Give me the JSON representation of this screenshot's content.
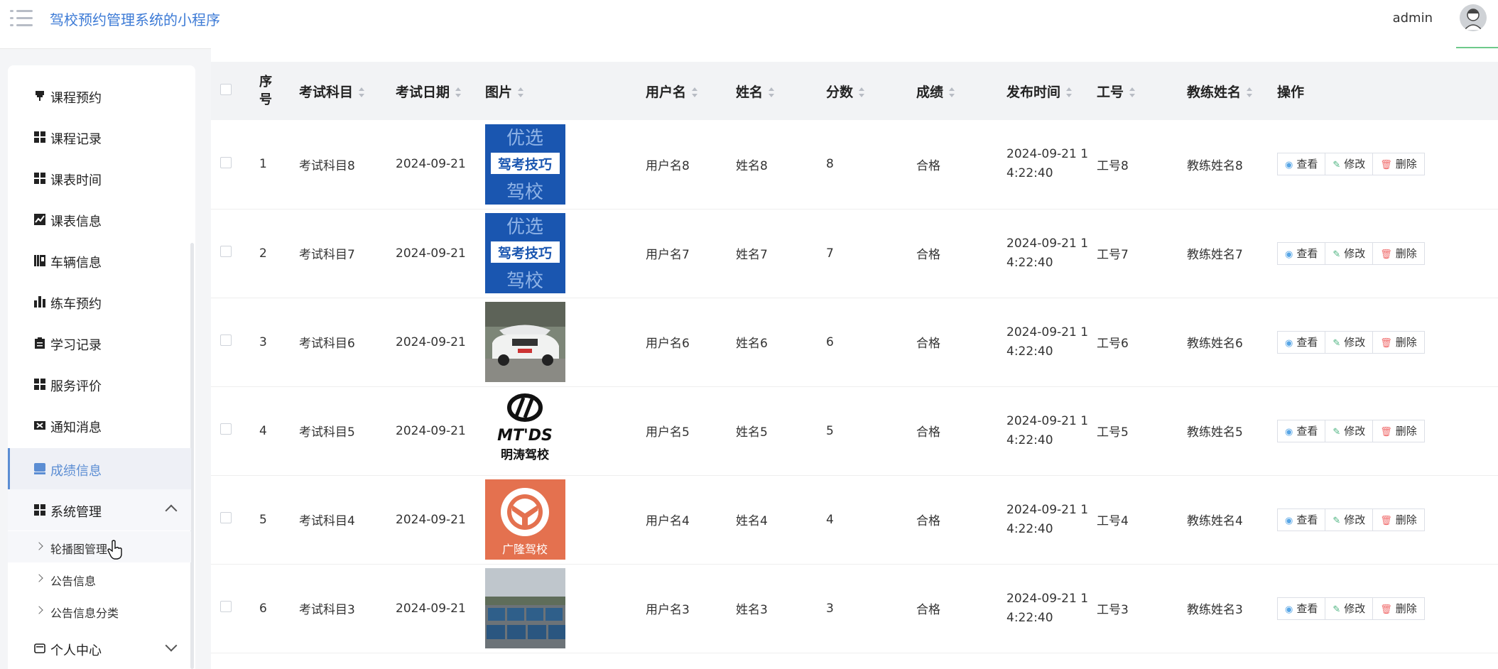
{
  "header": {
    "app_title": "驾校预约管理系统的小程序",
    "user_name": "admin"
  },
  "sidebar": {
    "items": [
      {
        "label": "课程预约",
        "icon": "pin-icon"
      },
      {
        "label": "课程记录",
        "icon": "grid-icon"
      },
      {
        "label": "课表时间",
        "icon": "grid-icon"
      },
      {
        "label": "课表信息",
        "icon": "chart-line-icon"
      },
      {
        "label": "车辆信息",
        "icon": "books-icon"
      },
      {
        "label": "练车预约",
        "icon": "bar-chart-icon"
      },
      {
        "label": "学习记录",
        "icon": "clipboard-icon"
      },
      {
        "label": "服务评价",
        "icon": "grid-icon"
      },
      {
        "label": "通知消息",
        "icon": "swap-icon"
      },
      {
        "label": "成绩信息",
        "icon": "card-icon",
        "active": true
      },
      {
        "label": "系统管理",
        "icon": "grid-icon",
        "expanded": true
      }
    ],
    "sub_items": [
      "轮播图管理",
      "公告信息",
      "公告信息分类"
    ],
    "personal_center": "个人中心"
  },
  "table": {
    "columns": [
      "序号",
      "考试科目",
      "考试日期",
      "图片",
      "用户名",
      "姓名",
      "分数",
      "成绩",
      "发布时间",
      "工号",
      "教练姓名",
      "操作"
    ],
    "rows": [
      {
        "no": "1",
        "subject": "考试科目8",
        "date": "2024-09-21",
        "image": "blue-poster",
        "username": "用户名8",
        "name": "姓名8",
        "score": "8",
        "result": "合格",
        "time_line1": "2024-09-21 1",
        "time_line2": "4:22:40",
        "job_no": "工号8",
        "coach": "教练姓名8"
      },
      {
        "no": "2",
        "subject": "考试科目7",
        "date": "2024-09-21",
        "image": "blue-poster",
        "username": "用户名7",
        "name": "姓名7",
        "score": "7",
        "result": "合格",
        "time_line1": "2024-09-21 1",
        "time_line2": "4:22:40",
        "job_no": "工号7",
        "coach": "教练姓名7"
      },
      {
        "no": "3",
        "subject": "考试科目6",
        "date": "2024-09-21",
        "image": "car-photo",
        "username": "用户名6",
        "name": "姓名6",
        "score": "6",
        "result": "合格",
        "time_line1": "2024-09-21 1",
        "time_line2": "4:22:40",
        "job_no": "工号6",
        "coach": "教练姓名6"
      },
      {
        "no": "4",
        "subject": "考试科目5",
        "date": "2024-09-21",
        "image": "mtds-logo",
        "username": "用户名5",
        "name": "姓名5",
        "score": "5",
        "result": "合格",
        "time_line1": "2024-09-21 1",
        "time_line2": "4:22:40",
        "job_no": "工号5",
        "coach": "教练姓名5"
      },
      {
        "no": "5",
        "subject": "考试科目4",
        "date": "2024-09-21",
        "image": "orange-logo",
        "username": "用户名4",
        "name": "姓名4",
        "score": "4",
        "result": "合格",
        "time_line1": "2024-09-21 1",
        "time_line2": "4:22:40",
        "job_no": "工号4",
        "coach": "教练姓名4"
      },
      {
        "no": "6",
        "subject": "考试科目3",
        "date": "2024-09-21",
        "image": "cars-lot-photo",
        "username": "用户名3",
        "name": "姓名3",
        "score": "3",
        "result": "合格",
        "time_line1": "2024-09-21 1",
        "time_line2": "4:22:40",
        "job_no": "工号3",
        "coach": "教练姓名3"
      }
    ],
    "actions": {
      "view": "查看",
      "edit": "修改",
      "delete": "删除"
    }
  },
  "image_text": {
    "poster_top": "优选",
    "poster_banner": "驾考技巧",
    "poster_bottom": "驾校",
    "mtds_latin": "MT'DS",
    "mtds_cn": "明涛驾校",
    "orange_cn": "广隆驾校"
  },
  "colors": {
    "accent": "#3d7bd6",
    "active_nav": "#5b8dd3",
    "poster_blue": "#1a56b0",
    "orange_logo": "#e4714f"
  }
}
